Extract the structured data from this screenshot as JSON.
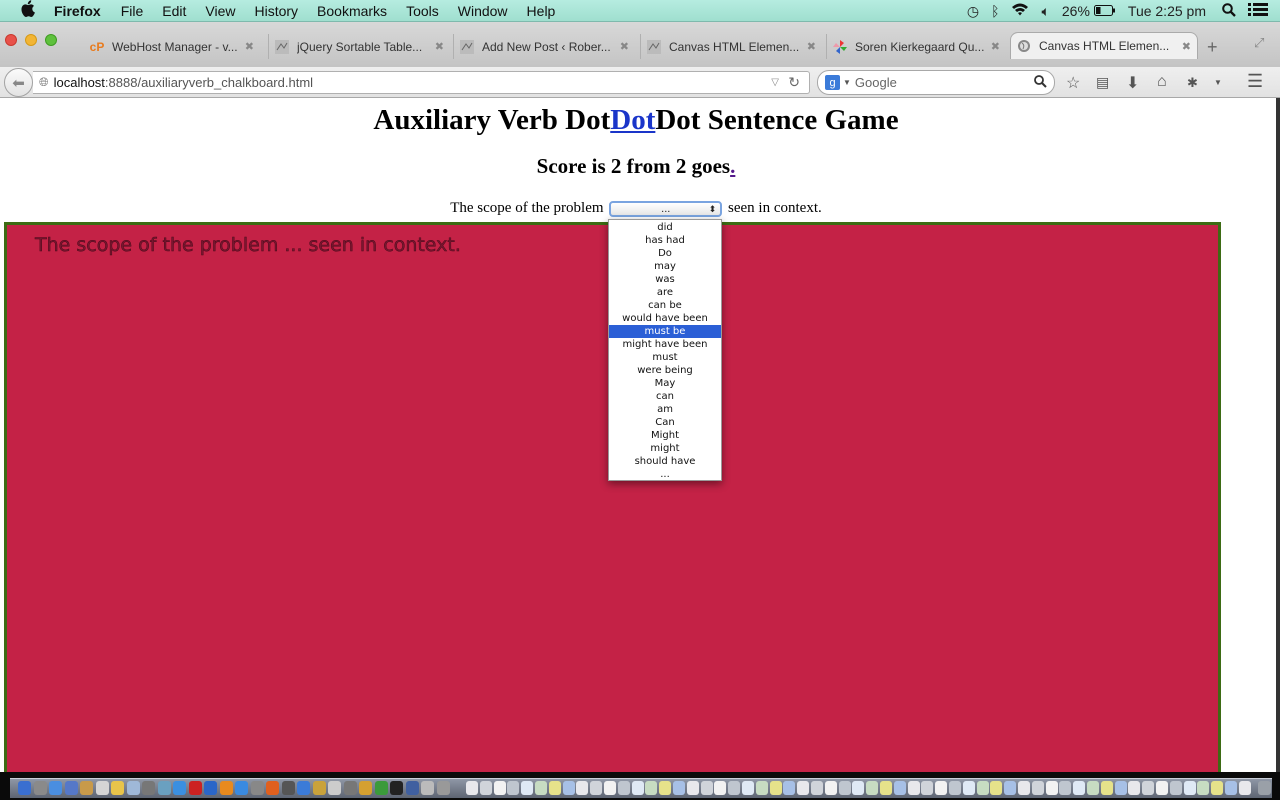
{
  "menubar": {
    "apple_icon": "apple-logo-icon",
    "app_name": "Firefox",
    "menus": [
      "File",
      "Edit",
      "View",
      "History",
      "Bookmarks",
      "Tools",
      "Window",
      "Help"
    ],
    "status": {
      "time_machine_icon": "clock-icon",
      "bluetooth_icon": "bluetooth-icon",
      "wifi_icon": "wifi-icon",
      "volume_icon": "speaker-icon",
      "battery_percent": "26%",
      "battery_icon": "battery-icon",
      "clock": "Tue 2:25 pm",
      "spotlight_icon": "search-icon",
      "notifications_icon": "list-icon"
    }
  },
  "tabs": [
    {
      "title": "WebHost Manager - v...",
      "favicon": "cpanel-icon",
      "active": false
    },
    {
      "title": "jQuery Sortable Table...",
      "favicon": "site-icon",
      "active": false
    },
    {
      "title": "Add New Post ‹ Rober...",
      "favicon": "site-icon",
      "active": false
    },
    {
      "title": "Canvas HTML Elemen...",
      "favicon": "site-icon",
      "active": false
    },
    {
      "title": "Soren Kierkegaard Qu...",
      "favicon": "pinwheel-icon",
      "active": false
    },
    {
      "title": "Canvas HTML Elemen...",
      "favicon": "globe-icon",
      "active": true
    }
  ],
  "tab_close_glyph": "✖",
  "new_tab_glyph": "+",
  "navbar": {
    "url_host": "localhost",
    "url_rest": ":8888/auxiliaryverb_chalkboard.html",
    "search_placeholder": "Google",
    "search_engine_glyph": "g"
  },
  "page": {
    "title_prefix": "Auxiliary Verb Dot",
    "title_link": "Dot",
    "title_suffix": "Dot Sentence Game",
    "score_text": "Score is 2 from 2 goes",
    "score_link": ".",
    "sentence_before": "The scope of the problem",
    "sentence_after": "seen in context.",
    "select_value": "...",
    "chalkboard_text": "The scope of the problem ... seen in context.",
    "chalkboard_color": "#c42246",
    "chalkboard_border_color": "#3d6b14"
  },
  "dropdown": {
    "options": [
      "did",
      "has had",
      "Do",
      "may",
      "was",
      "are",
      "can be",
      "would have been",
      "must be",
      "might have been",
      "must",
      "were being",
      "May",
      "can",
      "am",
      "Can",
      "Might",
      "might",
      "should have",
      "..."
    ],
    "highlighted": "must be",
    "highlight_color": "#2b5fd6"
  }
}
